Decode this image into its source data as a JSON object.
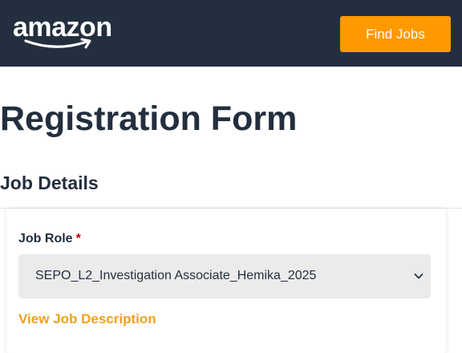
{
  "header": {
    "logo_text": "amazon",
    "find_jobs_label": "Find Jobs",
    "accent_color": "#ff9900",
    "background_color": "#232f3e"
  },
  "main": {
    "title": "Registration Form",
    "section_title": "Job Details",
    "job_role": {
      "label": "Job Role",
      "required_mark": "*",
      "selected_value": "SEPO_L2_Investigation Associate_Hemika_2025",
      "icon": "chevron-down-icon"
    },
    "view_description_link": "View Job Description"
  }
}
